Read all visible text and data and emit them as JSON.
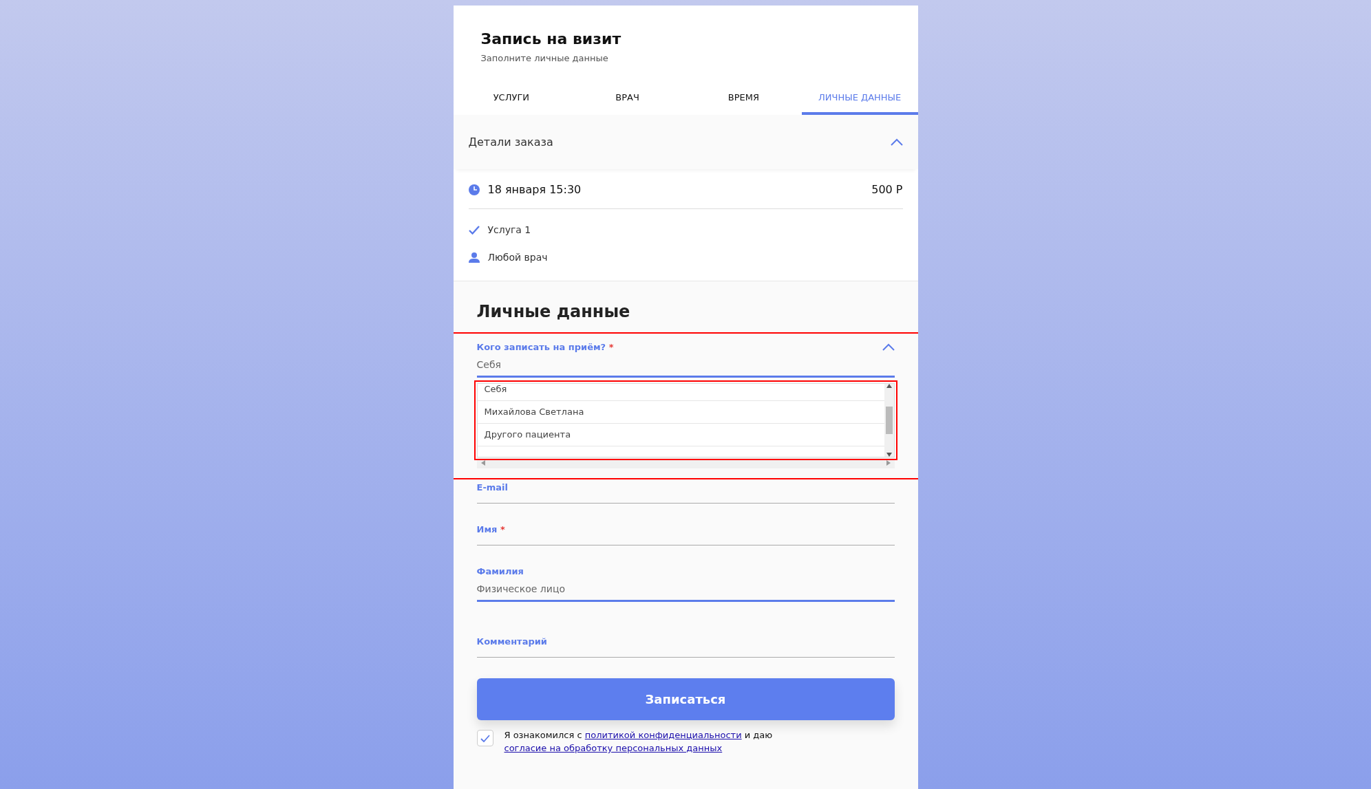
{
  "header": {
    "title": "Запись на визит",
    "subtitle": "Заполните личные данные"
  },
  "tabs": [
    {
      "label": "УСЛУГИ",
      "selected": false
    },
    {
      "label": "ВРАЧ",
      "selected": false
    },
    {
      "label": "ВРЕМЯ",
      "selected": false
    },
    {
      "label": "ЛИЧНЫЕ ДАННЫЕ",
      "selected": true
    }
  ],
  "order_details": {
    "title": "Детали заказа",
    "expanded": true,
    "datetime": "18 января 15:30",
    "price": "500 Р",
    "service": "Услуга 1",
    "doctor": "Любой врач"
  },
  "form": {
    "title": "Личные данные",
    "patient_select": {
      "label": "Кого записать на приём?",
      "required_mark": "*",
      "value": "Себя",
      "expanded": true,
      "outlined": true,
      "options_outlined": true,
      "options": [
        "Себя",
        "Михайлова Светлана",
        "Другого пациента"
      ]
    },
    "fields": [
      {
        "label": "E-mail",
        "focused": false
      },
      {
        "label": "Имя",
        "required_mark": "*",
        "focused": false
      },
      {
        "label": "Фамилия",
        "value": "Физическое лицо",
        "focused": true
      },
      {
        "label": "Комментарий",
        "focused": false
      }
    ],
    "submit": "Записаться",
    "consent": {
      "checked": true,
      "text_before": "Я ознакомился с",
      "link_1": "политикой конфиденциальности",
      "text_middle": "и даю",
      "link_2": "согласие на обработку персональных данных"
    }
  }
}
